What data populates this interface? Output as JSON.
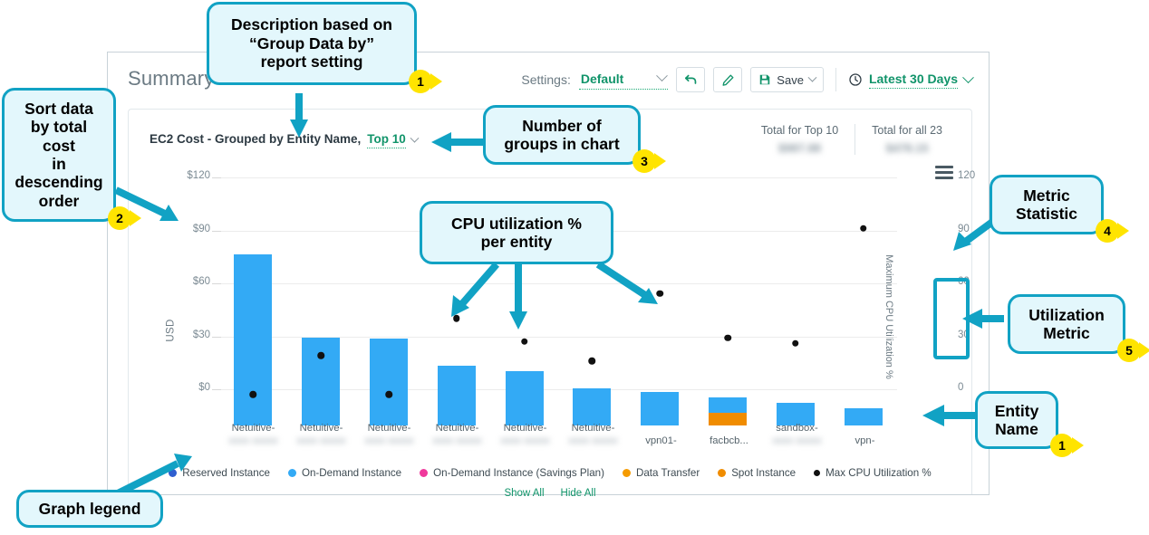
{
  "window": {
    "page_title": "Summary"
  },
  "toolbar": {
    "settings_label": "Settings:",
    "settings_value": "Default",
    "undo_icon": "undo-arrow-icon",
    "edit_icon": "pencil-icon",
    "save_icon": "floppy-disk-icon",
    "save_label": "Save",
    "clock_icon": "clock-icon",
    "date_range": "Latest 30 Days"
  },
  "chart_header": {
    "title": "EC2 Cost - Grouped by Entity Name,",
    "top_n": "Top 10",
    "total_top_label": "Total for Top 10",
    "total_top_value": "$987.88",
    "total_all_label": "Total for all 23",
    "total_all_value": "$478.15",
    "menu_icon": "hamburger-menu-icon"
  },
  "chart_data": {
    "type": "bar",
    "title": "EC2 Cost - Grouped by Entity Name, Top 10",
    "xlabel": "",
    "ylabel": "USD",
    "y2label": "Maximum CPU Utilization %",
    "ylim": [
      0,
      120
    ],
    "y2lim": [
      0,
      120
    ],
    "yticks": [
      "$0",
      "$30",
      "$60",
      "$90",
      "$120"
    ],
    "ytick_values": [
      0,
      30,
      60,
      90,
      120
    ],
    "y2ticks": [
      "0",
      "30",
      "60",
      "90",
      "120"
    ],
    "y2tick_values": [
      0,
      30,
      60,
      90,
      120
    ],
    "grid": true,
    "legend_position": "bottom",
    "categories": [
      "Netuitive-",
      "Netuitive-",
      "Netuitive-",
      "Netuitive-",
      "Netuitive-",
      "Netuitive-",
      "vpn01-",
      "facbcb...",
      "sandbox-",
      "vpn-"
    ],
    "category_redacted": [
      true,
      true,
      true,
      true,
      true,
      true,
      true,
      false,
      true,
      true
    ],
    "series": [
      {
        "name": "Reserved Instance",
        "color": "#2f5fd0",
        "values": [
          0,
          0,
          0,
          0,
          0,
          0,
          0,
          0,
          0,
          0
        ]
      },
      {
        "name": "On-Demand Instance",
        "color": "#33aaf5",
        "values": [
          97,
          50,
          49,
          34,
          31,
          21,
          19,
          9,
          13,
          10
        ]
      },
      {
        "name": "On-Demand Instance (Savings Plan)",
        "color": "#f0399c",
        "values": [
          0,
          0,
          0,
          0,
          0,
          0,
          0,
          0,
          0,
          0
        ]
      },
      {
        "name": "Data Transfer",
        "color": "#f59b00",
        "values": [
          0,
          0,
          0,
          0,
          0,
          0,
          0,
          0,
          0,
          0
        ]
      },
      {
        "name": "Spot Instance",
        "color": "#f08c00",
        "values": [
          0,
          0,
          0,
          0,
          0,
          0,
          0,
          7,
          0,
          0
        ]
      }
    ],
    "scatter": {
      "name": "Max CPU Utilization %",
      "color": "#111111",
      "values": [
        1,
        23,
        1,
        44,
        31,
        20,
        58,
        33,
        30,
        95
      ]
    },
    "legend": [
      {
        "label": "Reserved Instance",
        "color": "#2f5fd0",
        "marker": "circle"
      },
      {
        "label": "On-Demand Instance",
        "color": "#33aaf5",
        "marker": "circle"
      },
      {
        "label": "On-Demand Instance (Savings Plan)",
        "color": "#f0399c",
        "marker": "circle"
      },
      {
        "label": "Data Transfer",
        "color": "#f59b00",
        "marker": "circle"
      },
      {
        "label": "Spot Instance",
        "color": "#f08c00",
        "marker": "circle"
      },
      {
        "label": "Max CPU Utilization %",
        "color": "#111111",
        "marker": "dot"
      }
    ],
    "legend_links": [
      "Show All",
      "Hide All"
    ]
  },
  "callouts": [
    {
      "id": "description",
      "text": "Description based on\n“Group Data by”\nreport setting",
      "badge": "1"
    },
    {
      "id": "sort-order",
      "text": "Sort data\nby total cost\nin\ndescending\norder",
      "badge": "2"
    },
    {
      "id": "group-count",
      "text": "Number of\ngroups in chart",
      "badge": "3"
    },
    {
      "id": "cpu-util",
      "text": "CPU utilization %\nper entity",
      "badge": ""
    },
    {
      "id": "metric-stat",
      "text": "Metric\nStatistic",
      "badge": "4"
    },
    {
      "id": "util-metric",
      "text": "Utilization\nMetric",
      "badge": "5"
    },
    {
      "id": "entity-name",
      "text": "Entity\nName",
      "badge": "1"
    },
    {
      "id": "graph-legend",
      "text": "Graph legend",
      "badge": ""
    }
  ],
  "theme": {
    "callout_border": "#11a2c4",
    "callout_fill": "#e3f7fc",
    "badge_fill": "#ffe400",
    "accent_green": "#11946a",
    "bar_blue": "#33aaf5",
    "bar_orange": "#f08c00"
  }
}
